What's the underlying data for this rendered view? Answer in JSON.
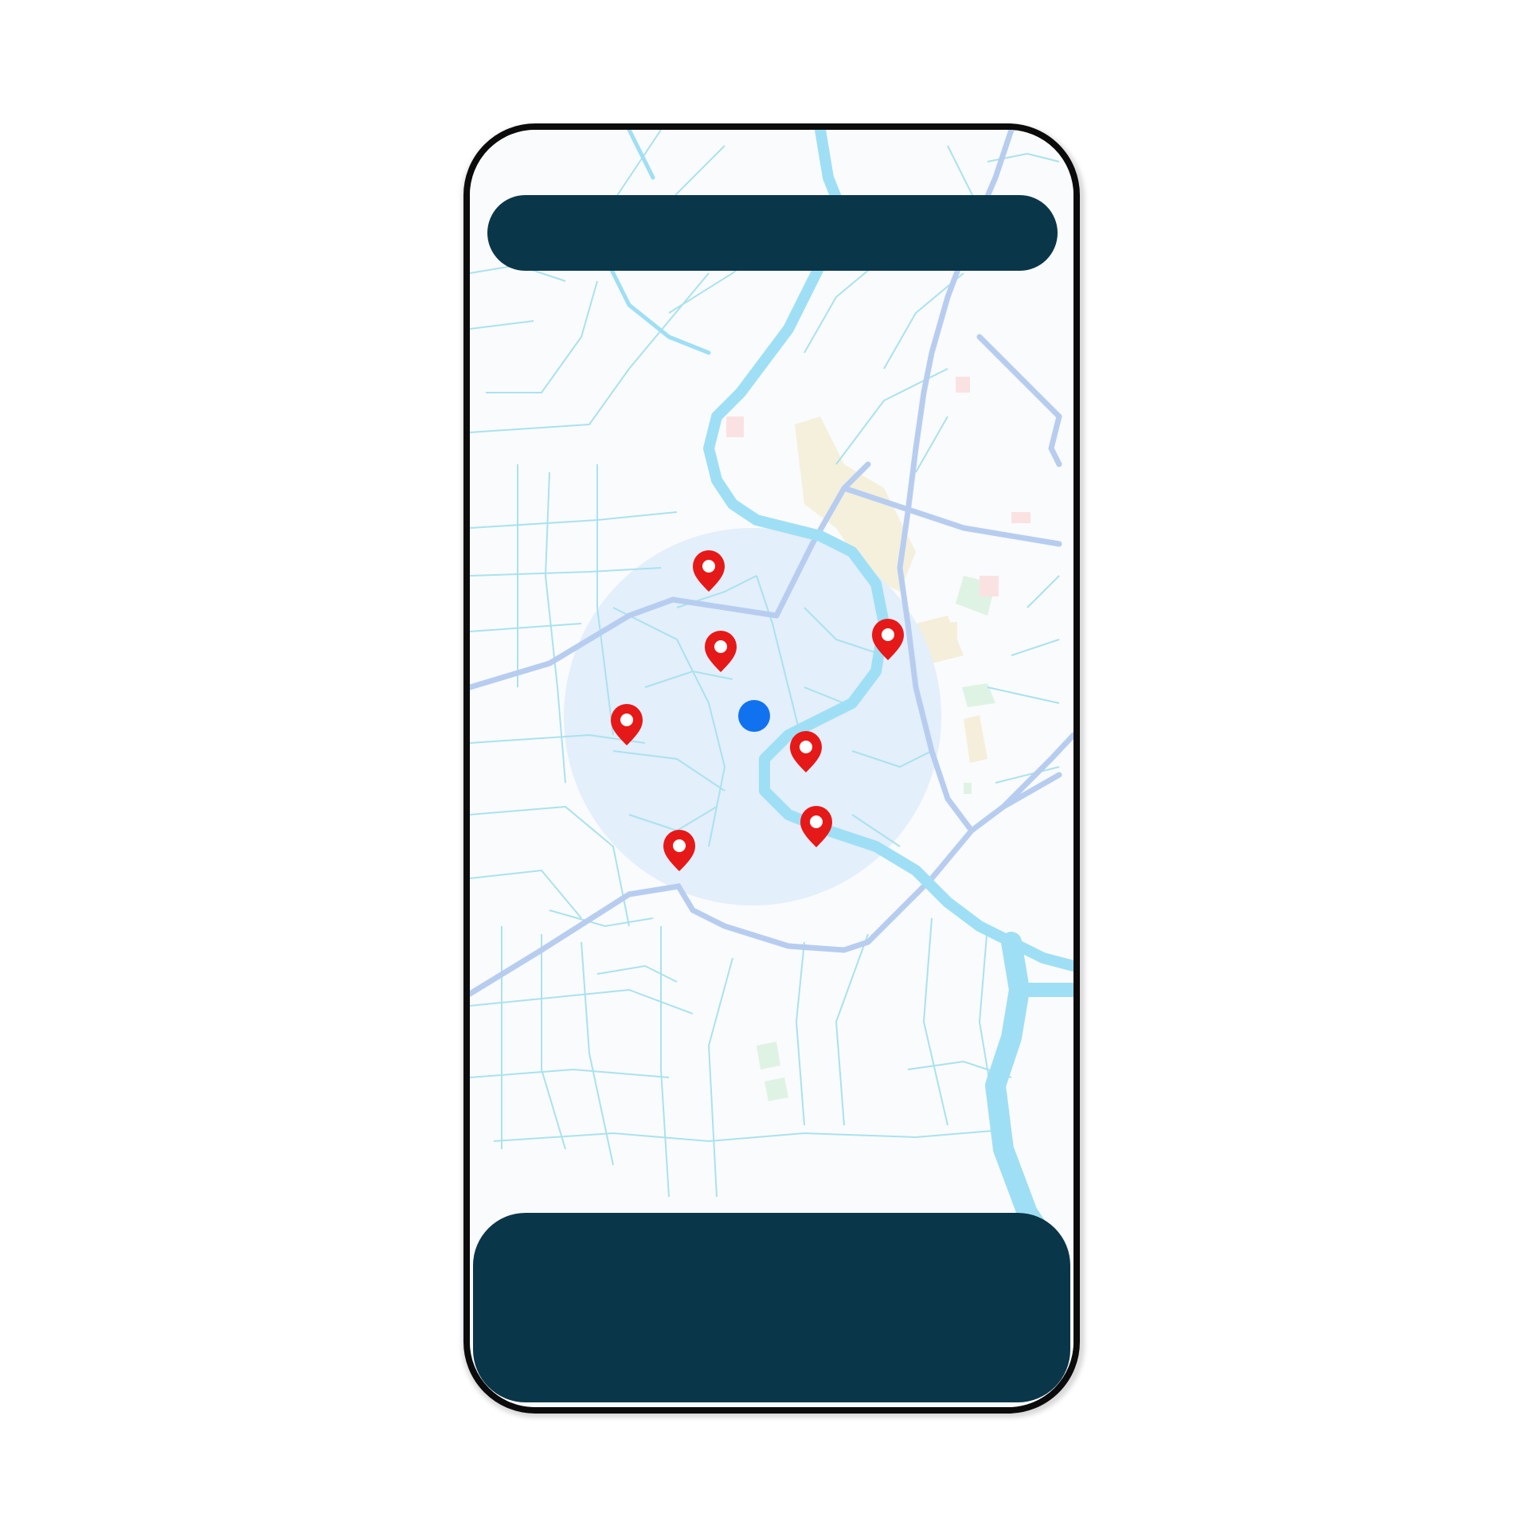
{
  "app": {
    "top_bar": {
      "label": ""
    },
    "bottom_panel": {
      "label": ""
    }
  },
  "map": {
    "water_color": "#9fdff5",
    "road_color": "#b7cdf0",
    "street_color": "#a9e2ef",
    "radius_fill": "#e3effb",
    "current_location": {
      "icon": "current-location-dot",
      "color": "#1172f0"
    },
    "pins": [
      {
        "icon": "map-pin-icon",
        "color": "#e61919"
      },
      {
        "icon": "map-pin-icon",
        "color": "#e61919"
      },
      {
        "icon": "map-pin-icon",
        "color": "#e61919"
      },
      {
        "icon": "map-pin-icon",
        "color": "#e61919"
      },
      {
        "icon": "map-pin-icon",
        "color": "#e61919"
      },
      {
        "icon": "map-pin-icon",
        "color": "#e61919"
      },
      {
        "icon": "map-pin-icon",
        "color": "#e61919"
      }
    ]
  }
}
